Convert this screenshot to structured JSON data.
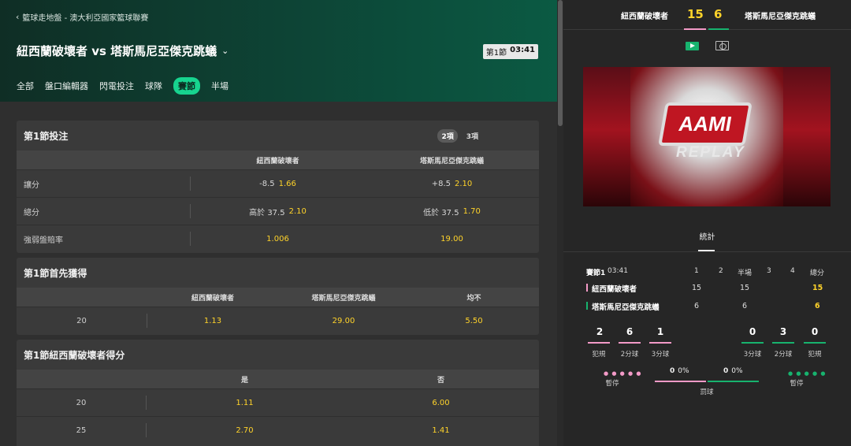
{
  "breadcrumb": "籃球走地盤 - 澳大利亞國家籃球聯賽",
  "match": {
    "title": "紐西蘭破壞者 vs 塔斯馬尼亞傑克跳蟻",
    "period": "第1節",
    "clock": "03:41"
  },
  "tabs": [
    {
      "label": "全部",
      "active": false
    },
    {
      "label": "盤口編輯器",
      "active": false
    },
    {
      "label": "閃電投注",
      "active": false
    },
    {
      "label": "球隊",
      "active": false
    },
    {
      "label": "賽節",
      "active": true
    },
    {
      "label": "半場",
      "active": false
    }
  ],
  "card1": {
    "title": "第1節投注",
    "toggle": [
      "2項",
      "3項"
    ],
    "columns": [
      "紐西蘭破壞者",
      "塔斯馬尼亞傑克跳蟻"
    ],
    "rows": [
      {
        "label": "讓分",
        "a_line": "-8.5",
        "a_odds": "1.66",
        "b_line": "+8.5",
        "b_odds": "2.10"
      },
      {
        "label": "總分",
        "a_line": "高於 37.5",
        "a_odds": "2.10",
        "b_line": "低於 37.5",
        "b_odds": "1.70"
      },
      {
        "label": "強弱盤賠率",
        "a_line": "",
        "a_odds": "1.006",
        "b_line": "",
        "b_odds": "19.00"
      }
    ]
  },
  "card2": {
    "title": "第1節首先獲得",
    "columns": [
      "紐西蘭破壞者",
      "塔斯馬尼亞傑克跳蟻",
      "均不"
    ],
    "rows": [
      {
        "label": "20",
        "a": "1.13",
        "b": "29.00",
        "c": "5.50"
      }
    ]
  },
  "card3": {
    "title": "第1節紐西蘭破壞者得分",
    "columns": [
      "是",
      "否"
    ],
    "rows": [
      {
        "label": "20",
        "yes": "1.11",
        "no": "6.00"
      },
      {
        "label": "25",
        "yes": "2.70",
        "no": "1.41"
      }
    ]
  },
  "scoreboard": {
    "team_a": "紐西蘭破壞者",
    "team_b": "塔斯馬尼亞傑克跳蟻",
    "score_a": "15",
    "score_b": "6"
  },
  "video": {
    "logo": "AAMI",
    "caption": "REPLAY"
  },
  "stats": {
    "tab": "統計",
    "period_label": "賽節1",
    "clock": "03:41",
    "headers": [
      "1",
      "2",
      "半場",
      "3",
      "4",
      "總分"
    ],
    "team_a": {
      "name": "紐西蘭破壞者",
      "q": [
        "15",
        "",
        "15",
        "",
        ""
      ],
      "total": "15",
      "color": "#f39ac7"
    },
    "team_b": {
      "name": "塔斯馬尼亞傑克跳蟻",
      "q": [
        "6",
        "",
        "6",
        "",
        ""
      ],
      "total": "6",
      "color": "#17b36e"
    },
    "a_counts": [
      {
        "value": "2",
        "label": "犯規"
      },
      {
        "value": "6",
        "label": "2分球"
      },
      {
        "value": "1",
        "label": "3分球"
      }
    ],
    "b_counts": [
      {
        "value": "0",
        "label": "3分球"
      },
      {
        "value": "3",
        "label": "2分球"
      },
      {
        "value": "0",
        "label": "犯規"
      }
    ],
    "timeout_label": "暫停",
    "free_throw_label": "罰球",
    "ft_a_made": "0",
    "ft_a_pct": "0%",
    "ft_b_made": "0",
    "ft_b_pct": "0%"
  }
}
